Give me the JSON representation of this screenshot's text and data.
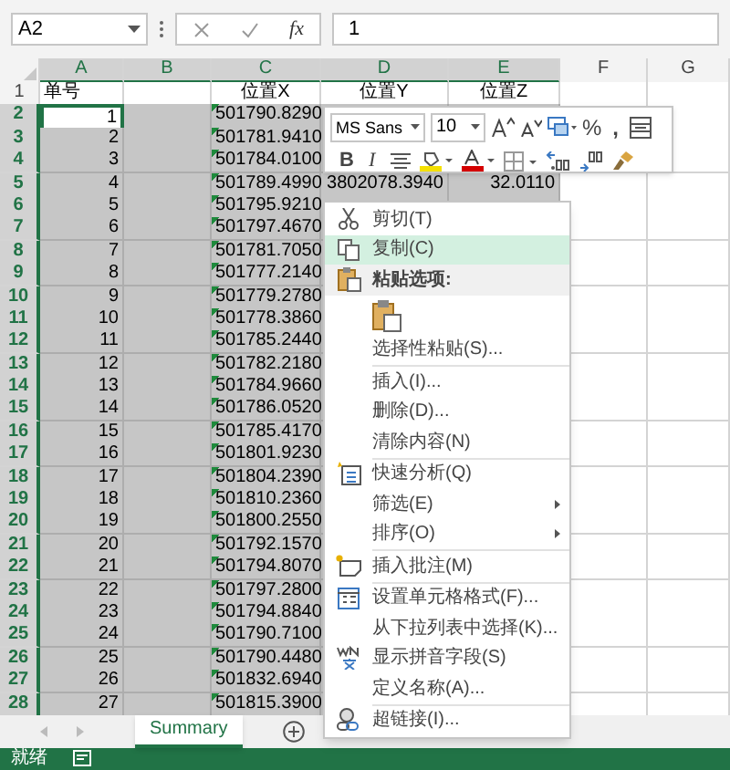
{
  "name_box": "A2",
  "formula_button": "fx",
  "formula_value": "1",
  "columns": [
    {
      "label": "A",
      "selected": true
    },
    {
      "label": "B",
      "selected": true
    },
    {
      "label": "C",
      "selected": true
    },
    {
      "label": "D",
      "selected": true
    },
    {
      "label": "E",
      "selected": true
    },
    {
      "label": "F",
      "selected": false
    },
    {
      "label": "G",
      "selected": false
    }
  ],
  "rows": [
    {
      "number": "1",
      "selected": false,
      "a": "单号",
      "c": "位置X",
      "d": "位置Y",
      "e": "位置Z"
    },
    {
      "number": "2",
      "selected": true,
      "active": true,
      "c_flag": true,
      "a": "1",
      "c": "501790.8290"
    },
    {
      "number": "3",
      "selected": true,
      "active": false,
      "c_flag": true,
      "a": "2",
      "c": "501781.9410"
    },
    {
      "number": "4",
      "selected": true,
      "active": false,
      "c_flag": true,
      "a": "3",
      "c": "501784.0100"
    },
    {
      "number": "5",
      "selected": true,
      "active": false,
      "c_flag": true,
      "a": "4",
      "c": "501789.4990",
      "d": "3802078.3940",
      "e": "32.0110"
    },
    {
      "number": "6",
      "selected": true,
      "active": false,
      "c_flag": true,
      "a": "5",
      "c": "501795.9210"
    },
    {
      "number": "7",
      "selected": true,
      "active": false,
      "c_flag": true,
      "a": "6",
      "c": "501797.4670"
    },
    {
      "number": "8",
      "selected": true,
      "active": false,
      "c_flag": true,
      "a": "7",
      "c": "501781.7050"
    },
    {
      "number": "9",
      "selected": true,
      "active": false,
      "c_flag": true,
      "a": "8",
      "c": "501777.2140"
    },
    {
      "number": "10",
      "selected": true,
      "active": false,
      "c_flag": true,
      "a": "9",
      "c": "501779.2780"
    },
    {
      "number": "11",
      "selected": true,
      "active": false,
      "c_flag": true,
      "a": "10",
      "c": "501778.3860"
    },
    {
      "number": "12",
      "selected": true,
      "active": false,
      "c_flag": true,
      "a": "11",
      "c": "501785.2440"
    },
    {
      "number": "13",
      "selected": true,
      "active": false,
      "c_flag": true,
      "a": "12",
      "c": "501782.2180"
    },
    {
      "number": "14",
      "selected": true,
      "active": false,
      "c_flag": true,
      "a": "13",
      "c": "501784.9660"
    },
    {
      "number": "15",
      "selected": true,
      "active": false,
      "c_flag": true,
      "a": "14",
      "c": "501786.0520"
    },
    {
      "number": "16",
      "selected": true,
      "active": false,
      "c_flag": true,
      "a": "15",
      "c": "501785.4170"
    },
    {
      "number": "17",
      "selected": true,
      "active": false,
      "c_flag": true,
      "a": "16",
      "c": "501801.9230"
    },
    {
      "number": "18",
      "selected": true,
      "active": false,
      "c_flag": true,
      "a": "17",
      "c": "501804.2390"
    },
    {
      "number": "19",
      "selected": true,
      "active": false,
      "c_flag": true,
      "a": "18",
      "c": "501810.2360"
    },
    {
      "number": "20",
      "selected": true,
      "active": false,
      "c_flag": true,
      "a": "19",
      "c": "501800.2550"
    },
    {
      "number": "21",
      "selected": true,
      "active": false,
      "c_flag": true,
      "a": "20",
      "c": "501792.1570"
    },
    {
      "number": "22",
      "selected": true,
      "active": false,
      "c_flag": true,
      "a": "21",
      "c": "501794.8070"
    },
    {
      "number": "23",
      "selected": true,
      "active": false,
      "c_flag": true,
      "a": "22",
      "c": "501797.2800"
    },
    {
      "number": "24",
      "selected": true,
      "active": false,
      "c_flag": true,
      "a": "23",
      "c": "501794.8840"
    },
    {
      "number": "25",
      "selected": true,
      "active": false,
      "c_flag": true,
      "a": "24",
      "c": "501790.7100"
    },
    {
      "number": "26",
      "selected": true,
      "active": false,
      "c_flag": true,
      "a": "25",
      "c": "501790.4480"
    },
    {
      "number": "27",
      "selected": true,
      "active": false,
      "c_flag": true,
      "a": "26",
      "c": "501832.6940"
    },
    {
      "number": "28",
      "selected": true,
      "active": false,
      "c_flag": true,
      "a": "27",
      "c": "501815.3900"
    }
  ],
  "sheet_tabs": [
    {
      "label": "Summary",
      "selected": true
    }
  ],
  "status_bar": {
    "text": "就绪"
  },
  "mini_toolbar": {
    "font": "MS Sans",
    "size": "10",
    "bold": "B",
    "italic": "I",
    "percent": "%",
    "comma": ","
  },
  "context_menu": [
    {
      "kind": "cut",
      "label": "剪切(T)",
      "selected": false,
      "submenu": false
    },
    {
      "kind": "copy",
      "label": "复制(C)",
      "selected": true,
      "submenu": false
    },
    {
      "kind": "paste_header",
      "label": "粘贴选项:"
    },
    {
      "kind": "paste_option"
    },
    {
      "kind": "item",
      "label": "选择性粘贴(S)...",
      "selected": false,
      "submenu": false
    },
    {
      "kind": "separator"
    },
    {
      "kind": "item",
      "label": "插入(I)...",
      "selected": false,
      "submenu": false
    },
    {
      "kind": "item",
      "label": "删除(D)...",
      "selected": false,
      "submenu": false
    },
    {
      "kind": "item",
      "label": "清除内容(N)",
      "selected": false,
      "submenu": false
    },
    {
      "kind": "separator"
    },
    {
      "kind": "quick_analysis",
      "label": "快速分析(Q)",
      "selected": false,
      "submenu": false
    },
    {
      "kind": "item",
      "label": "筛选(E)",
      "selected": false,
      "submenu": true
    },
    {
      "kind": "item",
      "label": "排序(O)",
      "selected": false,
      "submenu": true
    },
    {
      "kind": "separator"
    },
    {
      "kind": "comment",
      "label": "插入批注(M)",
      "selected": false,
      "submenu": false
    },
    {
      "kind": "separator"
    },
    {
      "kind": "format_cells",
      "label": "设置单元格格式(F)...",
      "selected": false,
      "submenu": false
    },
    {
      "kind": "item",
      "label": "从下拉列表中选择(K)...",
      "selected": false,
      "submenu": false
    },
    {
      "kind": "phonetic",
      "label": "显示拼音字段(S)",
      "selected": false,
      "submenu": false
    },
    {
      "kind": "item",
      "label": "定义名称(A)...",
      "selected": false,
      "submenu": false
    },
    {
      "kind": "separator"
    },
    {
      "kind": "hyperlink",
      "label": "超链接(I)...",
      "selected": false,
      "submenu": false
    }
  ]
}
